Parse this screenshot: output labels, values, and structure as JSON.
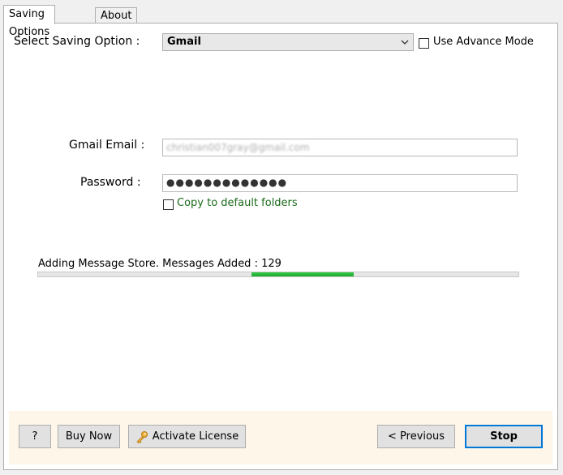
{
  "tabs": [
    {
      "label": "Saving Options",
      "active": true
    },
    {
      "label": "About",
      "active": false
    }
  ],
  "saving_option": {
    "label": "Select Saving Option :",
    "selected": "Gmail"
  },
  "advance_mode": {
    "label": "Use Advance Mode",
    "checked": false
  },
  "gmail_email": {
    "label": "Gmail Email :",
    "value": "christian007gray@gmail.com"
  },
  "password": {
    "label": "Password :",
    "value": "●●●●●●●●●●●●●"
  },
  "copy_default": {
    "label": "Copy to default folders",
    "checked": false
  },
  "progress": {
    "status": "Adding Message Store. Messages Added : 129",
    "fill_fraction": 0.21
  },
  "footer": {
    "help": "?",
    "buy_now": "Buy Now",
    "activate_license": "Activate License",
    "previous": "< Previous",
    "stop": "Stop"
  },
  "colors": {
    "progress": "#22b33a",
    "footer_bg": "#fdf6e9",
    "copy_label": "#1c6b1c",
    "stop_border": "#0078d7"
  }
}
